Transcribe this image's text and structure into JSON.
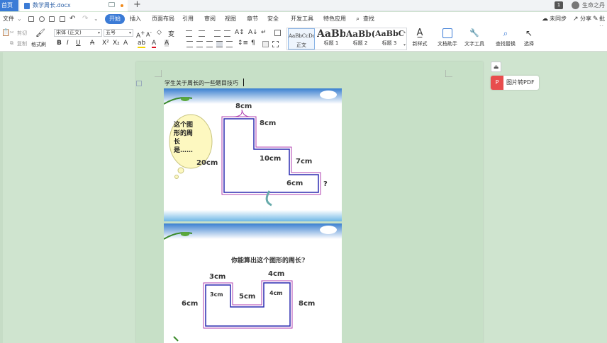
{
  "titlebar": {
    "home_tab": "首页",
    "doc_tab": "数学周长.docx",
    "new_tab": "+",
    "badge": "1",
    "user_name": "生命之丹"
  },
  "menubar": {
    "file": "文件",
    "items": [
      "开始",
      "插入",
      "页面布局",
      "引用",
      "审阅",
      "视图",
      "章节",
      "安全",
      "开发工具",
      "特色应用"
    ],
    "search": "查找",
    "sync": "未同步",
    "share": "分享",
    "review": "批注"
  },
  "ribbon": {
    "cut": "剪切",
    "copy": "复制",
    "format_painter": "格式刷",
    "font_name": "宋体 (正文)",
    "font_size": "五号",
    "styles": [
      {
        "sample": "AaBbCcDd",
        "label": "正文"
      },
      {
        "sample": "AaBb",
        "label": "标题 1"
      },
      {
        "sample": "AaBb(",
        "label": "标题 2"
      },
      {
        "sample": "AaBbC",
        "label": "标题 3"
      }
    ],
    "new_style": "新样式",
    "doc_helper": "文档助手",
    "text_tools": "文字工具",
    "find_replace": "查找替换",
    "select": "选择"
  },
  "document": {
    "line1": "学生关于周长的一些题目技巧",
    "figure1": {
      "thought": [
        "这个图",
        "形的周",
        "长",
        "是……"
      ],
      "labels": {
        "top": "8cm",
        "right_top": "8cm",
        "left": "20cm",
        "inner": "10cm",
        "right_mid": "7cm",
        "bottom": "6cm",
        "q": "?"
      }
    },
    "figure2": {
      "question": "你能算出这个图形的周长?",
      "labels": {
        "top_left": "3cm",
        "top_right": "4cm",
        "left": "6cm",
        "notch_left": "3cm",
        "notch_mid": "5cm",
        "notch_right": "4cm",
        "right": "8cm"
      }
    }
  },
  "side": {
    "pdf_label": "图片转PDF"
  }
}
